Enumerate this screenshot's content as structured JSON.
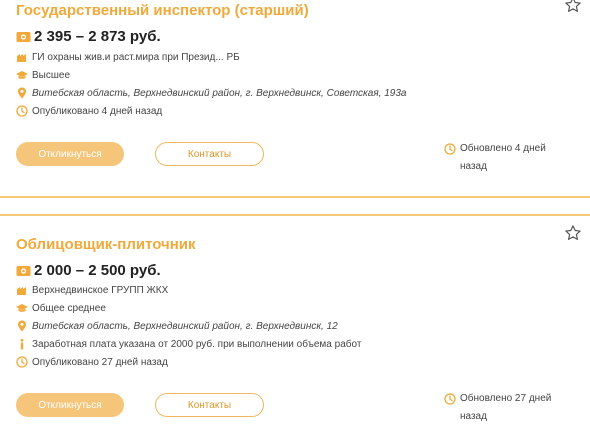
{
  "colors": {
    "accent": "#f0a93a",
    "button_fill": "#f5c57a",
    "divider": "#f4c978"
  },
  "vacancies": [
    {
      "title": "Государственный инспектор (старший)",
      "salary": "2 395 – 2 873 руб.",
      "employer": "ГИ охраны жив.и раст.мира при Презид... РБ",
      "education": "Высшее",
      "address": "Витебская область, Верхнедвинский район, г. Верхнедвинск, Советская, 193а",
      "published": "Опубликовано 4 дней назад",
      "apply_label": "Откликнуться",
      "contacts_label": "Контакты",
      "updated": "Обновлено 4 дней назад"
    },
    {
      "title": "Облицовщик-плиточник",
      "salary": "2 000 – 2 500 руб.",
      "employer": "Верхнедвинское ГРУПП ЖКХ",
      "education": "Общее среднее",
      "address": "Витебская область, Верхнедвинский район, г. Верхнедвинск, 12",
      "note": "Заработная плата указана от 2000 руб. при выполнении объема работ",
      "published": "Опубликовано 27 дней назад",
      "apply_label": "Откликнуться",
      "contacts_label": "Контакты",
      "updated": "Обновлено 27 дней назад"
    }
  ]
}
